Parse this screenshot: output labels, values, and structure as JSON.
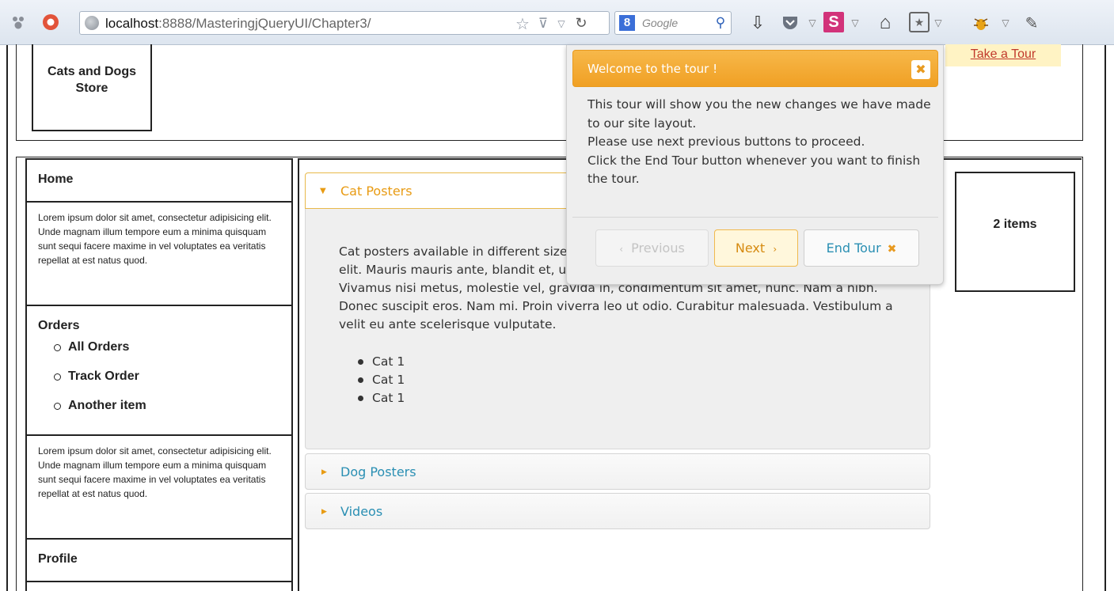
{
  "browser": {
    "url_host": "localhost",
    "url_rest": ":8888/MasteringjQueryUI/Chapter3/",
    "search_engine": "Google",
    "search_badge": "8"
  },
  "header": {
    "logo_text": "Cats and Dogs Store",
    "take_tour_link": "Take a Tour"
  },
  "sidebar": {
    "home": "Home",
    "lorem_1": "Lorem ipsum dolor sit amet, consectetur adipisicing elit. Unde magnam illum tempore eum a minima quisquam sunt sequi facere maxime in vel voluptates ea veritatis repellat at est natus quod.",
    "orders": "Orders",
    "order_items": [
      "All Orders",
      "Track Order",
      "Another item"
    ],
    "lorem_2": "Lorem ipsum dolor sit amet, consectetur adipisicing elit. Unde magnam illum tempore eum a minima quisquam sunt sequi facere maxime in vel voluptates ea veritatis repellat at est natus quod.",
    "profile": "Profile"
  },
  "accordion": {
    "sections": [
      "Cat Posters",
      "Dog Posters",
      "Videos"
    ],
    "cat_text": "Cat posters available in different sizes. Lorem ipsum dolor sit amet, consectetur adipiscing elit. Mauris mauris ante, blandit et, ultrices a, suscipit eget, quam. Integer ut neque. Vivamus nisi metus, molestie vel, gravida in, condimentum sit amet, nunc. Nam a nibh. Donec suscipit eros. Nam mi. Proin viverra leo ut odio. Curabitur malesuada. Vestibulum a velit eu ante scelerisque vulputate.",
    "cat_items": [
      "Cat 1",
      "Cat 1",
      "Cat 1"
    ]
  },
  "cart": {
    "count_text": "2 items"
  },
  "tour": {
    "title": "Welcome to the tour !",
    "close": "✖",
    "body": "This tour will show you the new changes we have made to our site layout.\nPlease use next previous buttons to proceed.\nClick the End Tour button whenever you want to finish the tour.",
    "prev_label": "Previous",
    "next_label": "Next",
    "end_label": "End Tour"
  },
  "colors": {
    "accent_orange": "#f0a024",
    "link_blue": "#2a8fb3",
    "tour_link_red": "#c0392b"
  }
}
